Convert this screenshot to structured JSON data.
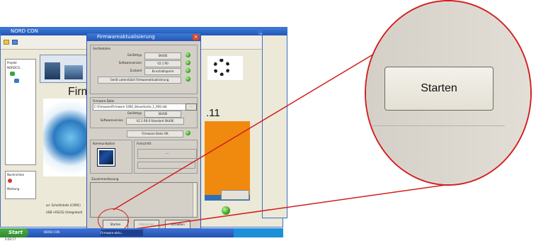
{
  "taskbar": {
    "start_label": "Start",
    "items": [
      "NORD CON",
      "Firmware-aktu..."
    ]
  },
  "background_window": {
    "title": "NORD CON",
    "banner_text": "Firm",
    "version_text": ".11",
    "left_panel": {
      "items": [
        "Projekt",
        "NORDCO..."
      ],
      "lower_items": [
        "Nachrichten",
        "Meldung"
      ]
    },
    "connection_lines": [
      "an: Schnittstelle (COM1)",
      "USB->RS232 (Integrated)"
    ],
    "status_text": "0:00:17"
  },
  "firmware_window": {
    "title": "Firmwareaktualisierung",
    "geraetedaten": {
      "group_label": "Gerätedaten",
      "rows": [
        {
          "label": "Gerätetyp",
          "value": "SK40E"
        },
        {
          "label": "Softwareversion",
          "value": "V2.1 R0"
        },
        {
          "label": "Zustand",
          "value": "Einschaltsperre"
        }
      ],
      "support_label": "Gerät unterstützt Firmwareaktualisierung"
    },
    "firmware_datei": {
      "group_label": "Firmware Datei",
      "path": "C:\\Firmware\\Firmware 5400_Steuerkarte_1_R00.dat",
      "browse_label": "...",
      "rows": [
        {
          "label": "Gerätetyp",
          "value": "SK40E"
        },
        {
          "label": "Softwareversion",
          "value": "V2.1 R0.0 Standard SK40E"
        }
      ],
      "ok_label": "Firmware Datei OK"
    },
    "kommunikation_label": "Kommunikation",
    "fortschritt_label": "Fortschritt",
    "fortschritt_value": "---",
    "zusammenfassung_label": "Zusammenfassung",
    "buttons": {
      "start": "Starten",
      "abort": "Abbrechen",
      "close": "Schließen"
    }
  },
  "zoom": {
    "button_label": "Starten"
  },
  "colors": {
    "callout": "#d21e1e",
    "led": "#35a81f",
    "titlebar": "#2355b8"
  }
}
